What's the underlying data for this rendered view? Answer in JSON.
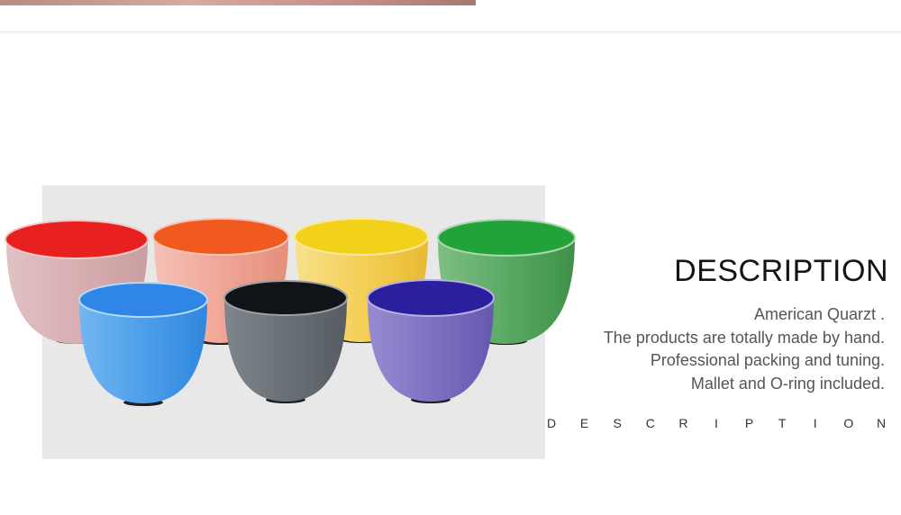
{
  "header": {
    "banner_color": "#c8958f",
    "rule_color": "#e3e3e3"
  },
  "product_image": {
    "panel_color": "#e8e8e8",
    "bowls": [
      {
        "name": "red-bowl-icon",
        "inner": "#e8201f",
        "outer": "#dcb7b8"
      },
      {
        "name": "orange-bowl-icon",
        "inner": "#f15a1f",
        "outer": "#f2b1a6"
      },
      {
        "name": "yellow-bowl-icon",
        "inner": "#f2d11a",
        "outer": "#f6d76b"
      },
      {
        "name": "green-bowl-icon",
        "inner": "#22a33a",
        "outer": "#62b16c"
      },
      {
        "name": "blue-bowl-icon",
        "inner": "#2f86e6",
        "outer": "#58a7ec"
      },
      {
        "name": "black-bowl-icon",
        "inner": "#101318",
        "outer": "#6b7277"
      },
      {
        "name": "purple-bowl-icon",
        "inner": "#2a1f9c",
        "outer": "#7e72c2"
      }
    ]
  },
  "description": {
    "heading": "DESCRIPTION",
    "lines": [
      "American Quarzt .",
      "The products are totally made by hand.",
      "Professional packing and tuning.",
      "Mallet and O-ring included."
    ],
    "spaced_letters": [
      "D",
      "E",
      "S",
      "C",
      "R",
      "I",
      "P",
      "T",
      "I",
      "O",
      "N"
    ]
  }
}
